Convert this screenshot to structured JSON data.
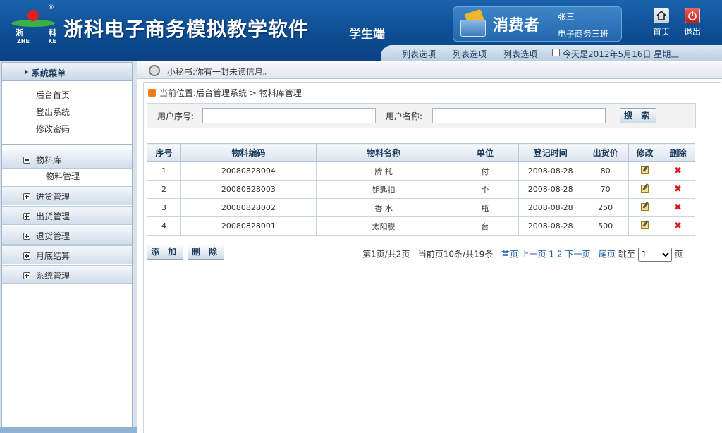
{
  "header": {
    "logo": {
      "cn_left": "浙",
      "cn_right": "科",
      "en_left": "ZHE",
      "en_right": "KE",
      "registered": "®"
    },
    "title": "浙科电子商务模拟教学软件",
    "subtitle": "学生端",
    "user": {
      "role": "消费者",
      "name": "张三",
      "class": "电子商务三班"
    },
    "buttons": {
      "home": "首页",
      "exit": "退出"
    },
    "nav": [
      "列表选项",
      "列表选项",
      "列表选项"
    ],
    "date": "今天是2012年5月16日 星期三"
  },
  "sidebar": {
    "title": "系统菜单",
    "links": [
      "后台首页",
      "登出系统",
      "修改密码"
    ],
    "sections": [
      {
        "label": "物料库",
        "expanded": true,
        "children": [
          "物料管理"
        ]
      },
      {
        "label": "进货管理",
        "expanded": false
      },
      {
        "label": "出货管理",
        "expanded": false
      },
      {
        "label": "退货管理",
        "expanded": false
      },
      {
        "label": "月底结算",
        "expanded": false
      },
      {
        "label": "系统管理",
        "expanded": false
      }
    ]
  },
  "notice": "小秘书:你有一封未读信息。",
  "breadcrumb": "当前位置:后台管理系统 > 物料库管理",
  "search": {
    "user_id_label": "用户序号:",
    "user_id_value": "",
    "user_name_label": "用户名称:",
    "user_name_value": "",
    "button": "搜 索"
  },
  "table": {
    "headers": [
      "序号",
      "物料编码",
      "物料名称",
      "单位",
      "登记时间",
      "出货价",
      "修改",
      "删除"
    ],
    "rows": [
      [
        "1",
        "20080828004",
        "牌 托",
        "付",
        "2008-08-28",
        "80"
      ],
      [
        "2",
        "20080828003",
        "钥匙扣",
        "个",
        "2008-08-28",
        "70"
      ],
      [
        "3",
        "20080828002",
        "香 水",
        "瓶",
        "2008-08-28",
        "250"
      ],
      [
        "4",
        "20080828001",
        "太阳膜",
        "台",
        "2008-08-28",
        "500"
      ]
    ]
  },
  "actions": {
    "add": "添 加",
    "delete": "删 除"
  },
  "pager": {
    "summary": "第1页/共2页",
    "count": "当前页10条/共19条",
    "first": "首页",
    "prev": "上一页",
    "pages": "1 2",
    "next": "下一页",
    "last": "尾页",
    "jump": "跳至",
    "page_value": "1",
    "page_unit": "页"
  },
  "colors": {
    "header_blue": "#0d4d93",
    "link_blue": "#1d5aa8",
    "delete_red": "#d81e1e"
  }
}
